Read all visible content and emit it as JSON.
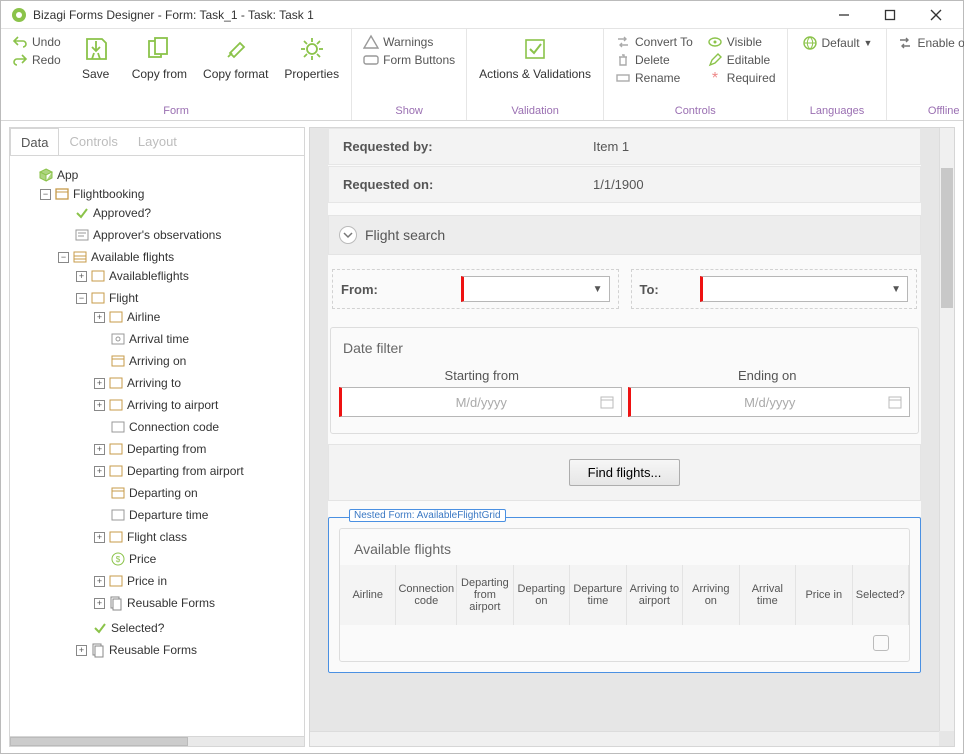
{
  "titlebar": {
    "text": "Bizagi Forms Designer  - Form: Task_1 - Task:  Task 1"
  },
  "ribbon": {
    "undo": "Undo",
    "redo": "Redo",
    "save": "Save",
    "copyfrom": "Copy from",
    "copyformat": "Copy format",
    "properties": "Properties",
    "warnings": "Warnings",
    "formbuttons": "Form Buttons",
    "actions": "Actions & Validations",
    "convertto": "Convert To",
    "delete": "Delete",
    "rename": "Rename",
    "visible": "Visible",
    "editable": "Editable",
    "required": "Required",
    "default": "Default",
    "offline": "Enable offline",
    "grp_form": "Form",
    "grp_show": "Show",
    "grp_validation": "Validation",
    "grp_controls": "Controls",
    "grp_languages": "Languages",
    "grp_offline": "Offline"
  },
  "tabs": {
    "data": "Data",
    "controls": "Controls",
    "layout": "Layout"
  },
  "tree": {
    "app": "App",
    "flightbooking": "Flightbooking",
    "approved": "Approved?",
    "approver_obs": "Approver's observations",
    "available_flights": "Available flights",
    "availableflights": "Availableflights",
    "flight": "Flight",
    "airline": "Airline",
    "arrival_time": "Arrival time",
    "arriving_on": "Arriving on",
    "arriving_to": "Arriving to",
    "arriving_to_airport": "Arriving to airport",
    "connection_code": "Connection code",
    "departing_from": "Departing from",
    "departing_from_airport": "Departing from airport",
    "departing_on": "Departing on",
    "departure_time": "Departure time",
    "flight_class": "Flight class",
    "price": "Price",
    "price_in": "Price in",
    "reusable_forms": "Reusable Forms",
    "selected": "Selected?",
    "reusable_forms2": "Reusable Forms"
  },
  "form": {
    "requested_by_label": "Requested by:",
    "requested_by_value": "Item 1",
    "requested_on_label": "Requested on:",
    "requested_on_value": "1/1/1900",
    "section_flight_search": "Flight search",
    "from_label": "From:",
    "to_label": "To:",
    "date_filter_title": "Date filter",
    "starting_from": "Starting from",
    "ending_on": "Ending on",
    "date_placeholder": "M/d/yyyy",
    "find_flights": "Find flights...",
    "nested_tag": "Nested Form: AvailableFlightGrid",
    "grid_title": "Available flights",
    "grid_cols": {
      "c1": "Airline",
      "c2": "Connection code",
      "c3": "Departing from airport",
      "c4": "Departing on",
      "c5": "Departure time",
      "c6": "Arriving to airport",
      "c7": "Arriving on",
      "c8": "Arrival time",
      "c9": "Price in",
      "c10": "Selected?"
    }
  }
}
